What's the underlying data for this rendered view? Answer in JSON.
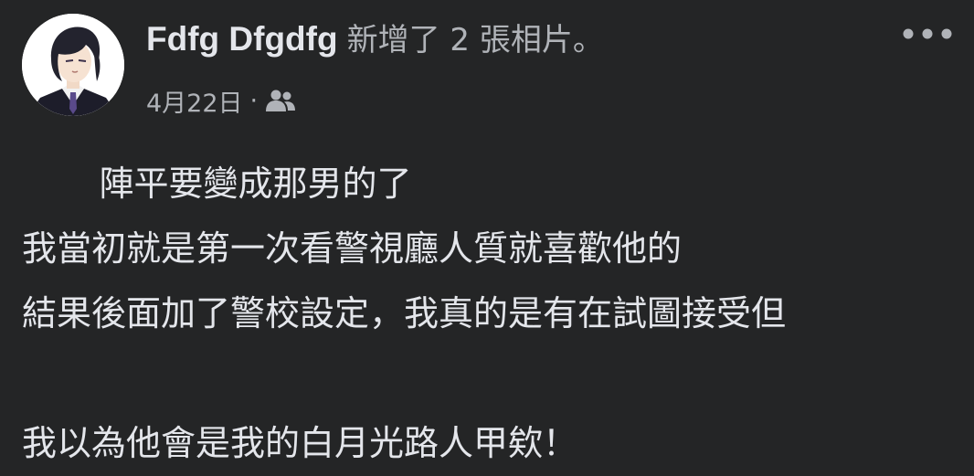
{
  "post": {
    "author_name": "Fdfg Dfgdfg",
    "action_text": "新增了 2 張相片。",
    "date": "4月22日",
    "separator": "·",
    "audience_icon": "friends-icon",
    "more_icon": "more-horizontal-icon",
    "body_lines": [
      "       陣平要變成那男的了",
      "我當初就是第一次看警視廳人質就喜歡他的",
      "結果後面加了警校設定，我真的是有在試圖接受但",
      "",
      "我以為他會是我的白月光路人甲欸！"
    ]
  },
  "colors": {
    "background": "#242526",
    "primary_text": "#e4e6eb",
    "secondary_text": "#b0b3b8"
  }
}
